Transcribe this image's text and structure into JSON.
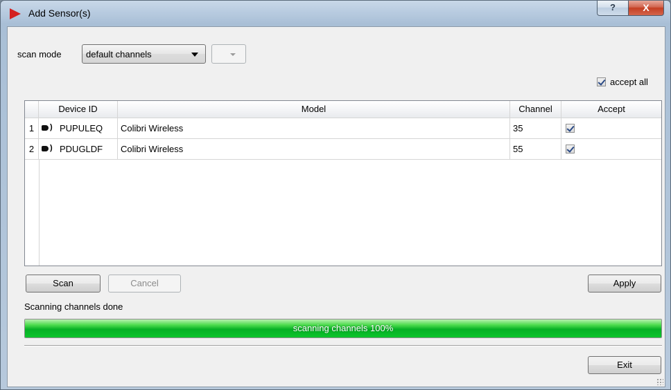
{
  "window": {
    "title": "Add Sensor(s)",
    "icon": "red-triangle-play-icon",
    "help_label": "?",
    "close_label": "X"
  },
  "scan": {
    "mode_label": "scan mode",
    "mode_value": "default channels",
    "secondary_value": ""
  },
  "accept_all": {
    "label": "accept all",
    "checked": true
  },
  "table": {
    "columns": [
      "Device ID",
      "Model",
      "Channel",
      "Accept"
    ],
    "rows": [
      {
        "num": "1",
        "device_id": "PUPULEQ",
        "model": "Colibri Wireless",
        "channel": "35",
        "accept": true
      },
      {
        "num": "2",
        "device_id": "PDUGLDF",
        "model": "Colibri Wireless",
        "channel": "55",
        "accept": true
      }
    ]
  },
  "buttons": {
    "scan": "Scan",
    "cancel": "Cancel",
    "apply": "Apply",
    "exit": "Exit"
  },
  "status": "Scanning channels done",
  "progress": {
    "label": "scanning channels 100%",
    "value": 100
  },
  "colors": {
    "progress": "#06b025",
    "close": "#c43e22"
  }
}
